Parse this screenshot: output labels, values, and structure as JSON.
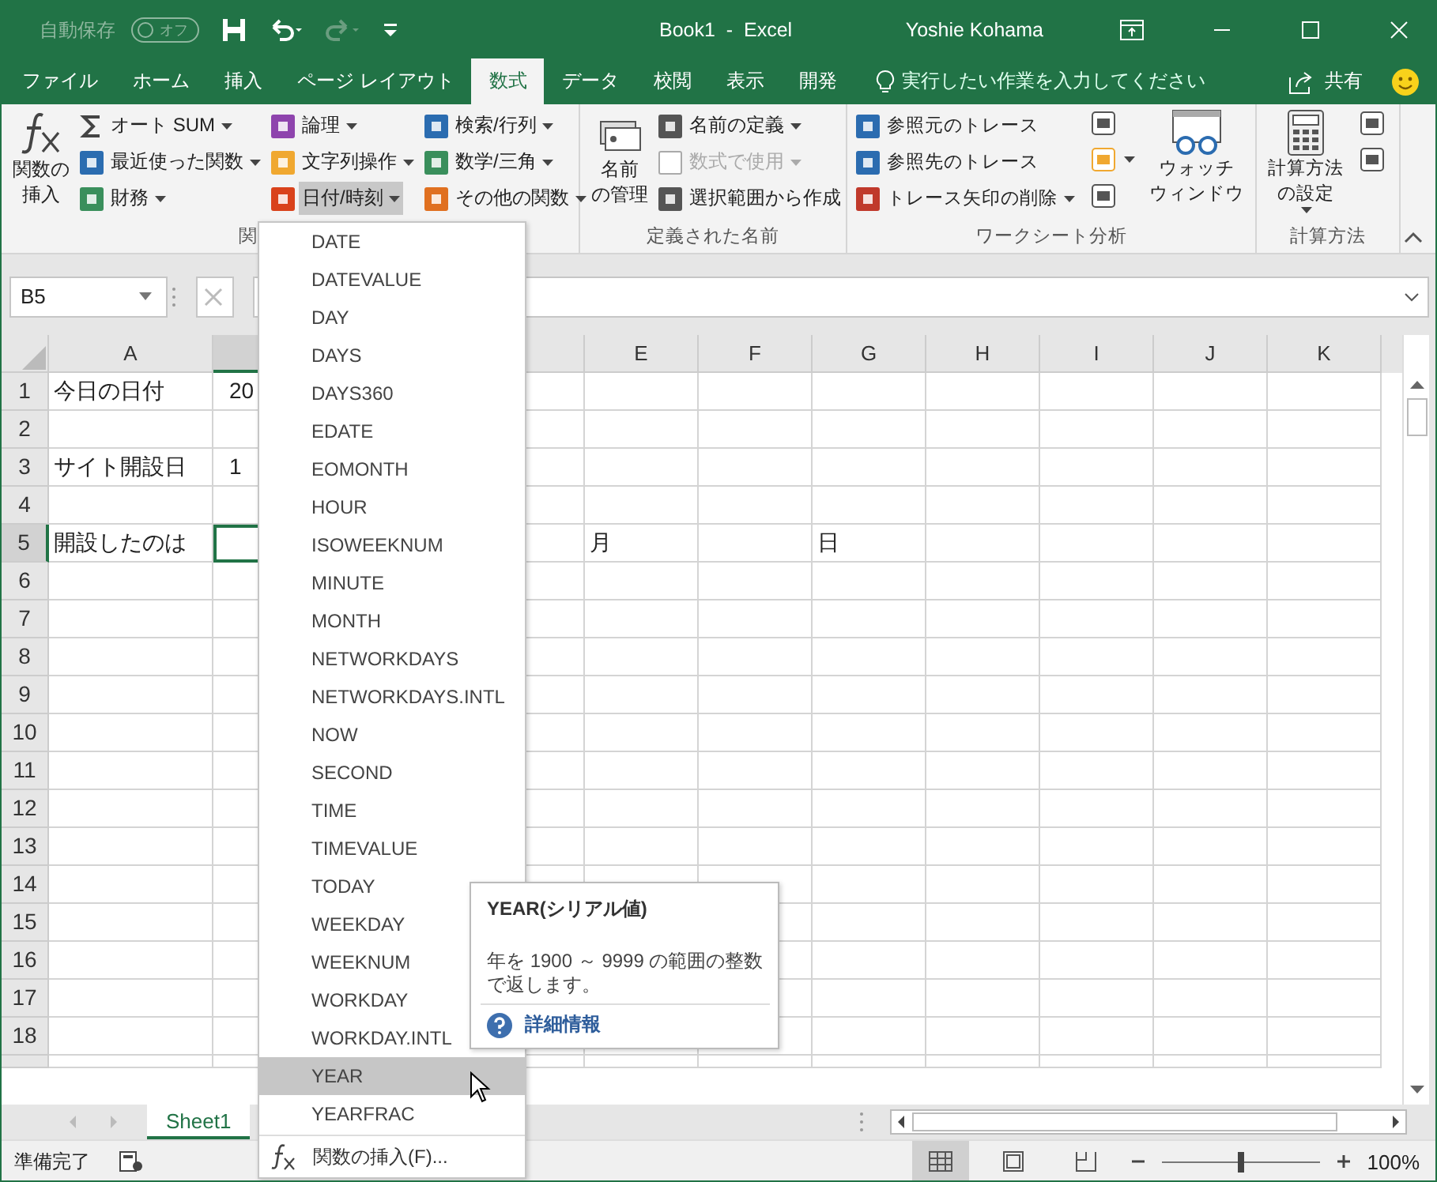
{
  "window": {
    "title": "Book1  -  Excel",
    "user": "Yoshie Kohama"
  },
  "quick_access": {
    "autosave_label": "自動保存",
    "autosave_toggle": {
      "label": "オフ",
      "on": false
    }
  },
  "tabs": [
    {
      "label": "ファイル",
      "selected": false
    },
    {
      "label": "ホーム",
      "selected": false
    },
    {
      "label": "挿入",
      "selected": false
    },
    {
      "label": "ページ レイアウト",
      "selected": false
    },
    {
      "label": "数式",
      "selected": true
    },
    {
      "label": "データ",
      "selected": false
    },
    {
      "label": "校閲",
      "selected": false
    },
    {
      "label": "表示",
      "selected": false
    },
    {
      "label": "開発",
      "selected": false
    }
  ],
  "tell_me": {
    "placeholder": "実行したい作業を入力してください"
  },
  "share": "共有",
  "ribbon": {
    "groups": [
      {
        "label": "関",
        "items": [
          {
            "kind": "large",
            "lines": [
              "関数の",
              "挿入"
            ],
            "dropdown": false
          },
          {
            "kind": "column",
            "buttons": [
              {
                "label": "オート SUM",
                "dropdown": true,
                "disabled": false,
                "pressed": false
              },
              {
                "label": "最近使った関数",
                "dropdown": true,
                "disabled": false,
                "pressed": false
              },
              {
                "label": "財務",
                "dropdown": true,
                "disabled": false,
                "pressed": false
              }
            ]
          },
          {
            "kind": "column",
            "buttons": [
              {
                "label": "論理",
                "dropdown": true,
                "disabled": false,
                "pressed": false
              },
              {
                "label": "文字列操作",
                "dropdown": true,
                "disabled": false,
                "pressed": false
              },
              {
                "label": "日付/時刻",
                "dropdown": true,
                "disabled": false,
                "pressed": true
              }
            ]
          },
          {
            "kind": "column",
            "buttons": [
              {
                "label": "検索/行列",
                "dropdown": true,
                "disabled": false,
                "pressed": false
              },
              {
                "label": "数学/三角",
                "dropdown": true,
                "disabled": false,
                "pressed": false
              },
              {
                "label": "その他の関数",
                "dropdown": true,
                "disabled": false,
                "pressed": false
              }
            ]
          }
        ]
      },
      {
        "label": "定義された名前",
        "items": [
          {
            "kind": "large",
            "lines": [
              "名前",
              "の管理"
            ],
            "dropdown": false
          },
          {
            "kind": "column",
            "buttons": [
              {
                "label": "名前の定義",
                "dropdown": true,
                "disabled": false,
                "pressed": false
              },
              {
                "label": "数式で使用",
                "dropdown": true,
                "disabled": true,
                "pressed": false
              },
              {
                "label": "選択範囲から作成",
                "dropdown": false,
                "disabled": false,
                "pressed": false
              }
            ]
          }
        ]
      },
      {
        "label": "ワークシート分析",
        "items": [
          {
            "kind": "column",
            "buttons": [
              {
                "label": "参照元のトレース",
                "dropdown": false,
                "disabled": false,
                "pressed": false
              },
              {
                "label": "参照先のトレース",
                "dropdown": false,
                "disabled": false,
                "pressed": false
              },
              {
                "label": "トレース矢印の削除",
                "dropdown": true,
                "disabled": false,
                "pressed": false
              }
            ]
          },
          {
            "kind": "icons",
            "icons": [
              {
                "dropdown": false
              },
              {
                "dropdown": true
              },
              {
                "dropdown": false
              }
            ]
          },
          {
            "kind": "large",
            "lines": [
              "ウォッチ",
              "ウィンドウ"
            ],
            "dropdown": false
          }
        ]
      },
      {
        "label": "計算方法",
        "items": [
          {
            "kind": "large",
            "lines": [
              "計算方法",
              "の設定"
            ],
            "dropdown": true
          },
          {
            "kind": "icons",
            "icons": [
              {
                "dropdown": false
              },
              {
                "dropdown": false
              }
            ]
          }
        ]
      }
    ]
  },
  "formula_bar": {
    "name_box": "B5"
  },
  "sheet": {
    "columns": [
      {
        "label": "A",
        "selected": false
      },
      {
        "selected": true
      },
      {
        "label": "E",
        "selected": false
      },
      {
        "label": "F",
        "selected": false
      },
      {
        "label": "G",
        "selected": false
      },
      {
        "label": "H",
        "selected": false
      },
      {
        "label": "I",
        "selected": false
      },
      {
        "label": "J",
        "selected": false
      },
      {
        "label": "K",
        "selected": false
      }
    ],
    "rows": [
      {
        "label": "1",
        "selected": false,
        "cells": [
          "今日の日付",
          "20"
        ]
      },
      {
        "label": "2",
        "selected": false,
        "cells": []
      },
      {
        "label": "3",
        "selected": false,
        "cells": [
          "サイト開設日",
          "1"
        ]
      },
      {
        "label": "4",
        "selected": false,
        "cells": []
      },
      {
        "label": "5",
        "selected": true,
        "cells": [
          "開設したのは",
          null,
          "月",
          null,
          "日"
        ]
      },
      {
        "label": "6",
        "selected": false,
        "cells": []
      },
      {
        "label": "7",
        "selected": false,
        "cells": []
      },
      {
        "label": "8",
        "selected": false,
        "cells": []
      },
      {
        "label": "9",
        "selected": false,
        "cells": []
      },
      {
        "label": "10",
        "selected": false,
        "cells": []
      },
      {
        "label": "11",
        "selected": false,
        "cells": []
      },
      {
        "label": "12",
        "selected": false,
        "cells": []
      },
      {
        "label": "13",
        "selected": false,
        "cells": []
      },
      {
        "label": "14",
        "selected": false,
        "cells": []
      },
      {
        "label": "15",
        "selected": false,
        "cells": []
      },
      {
        "label": "16",
        "selected": false,
        "cells": []
      },
      {
        "label": "17",
        "selected": false,
        "cells": []
      },
      {
        "label": "18",
        "selected": false,
        "cells": []
      }
    ]
  },
  "sheet_tabs": [
    {
      "label": "Sheet1",
      "selected": true
    }
  ],
  "menu": {
    "items": [
      {
        "label": "DATE",
        "selected": false
      },
      {
        "label": "DATEVALUE",
        "selected": false
      },
      {
        "label": "DAY",
        "selected": false
      },
      {
        "label": "DAYS",
        "selected": false
      },
      {
        "label": "DAYS360",
        "selected": false
      },
      {
        "label": "EDATE",
        "selected": false
      },
      {
        "label": "EOMONTH",
        "selected": false
      },
      {
        "label": "HOUR",
        "selected": false
      },
      {
        "label": "ISOWEEKNUM",
        "selected": false
      },
      {
        "label": "MINUTE",
        "selected": false
      },
      {
        "label": "MONTH",
        "selected": false
      },
      {
        "label": "NETWORKDAYS",
        "selected": false
      },
      {
        "label": "NETWORKDAYS.INTL",
        "selected": false
      },
      {
        "label": "NOW",
        "selected": false
      },
      {
        "label": "SECOND",
        "selected": false
      },
      {
        "label": "TIME",
        "selected": false
      },
      {
        "label": "TIMEVALUE",
        "selected": false
      },
      {
        "label": "TODAY",
        "selected": false
      },
      {
        "label": "WEEKDAY",
        "selected": false
      },
      {
        "label": "WEEKNUM",
        "selected": false
      },
      {
        "label": "WORKDAY",
        "selected": false
      },
      {
        "label": "WORKDAY.INTL",
        "selected": false
      },
      {
        "label": "YEAR",
        "selected": true
      },
      {
        "label": "YEARFRAC",
        "selected": false
      }
    ],
    "footer": "関数の挿入(F)..."
  },
  "tooltip": {
    "title": "YEAR(シリアル値)",
    "text": "年を 1900 ～ 9999 の範囲の整数で返します。",
    "link": "詳細情報"
  },
  "status_bar": {
    "text": "準備完了",
    "views": [
      {
        "kind": "normal",
        "selected": true
      },
      {
        "kind": "page-layout",
        "selected": false
      },
      {
        "kind": "page-break",
        "selected": false
      }
    ],
    "zoom": {
      "level": 0.5,
      "reading": "100%"
    }
  }
}
